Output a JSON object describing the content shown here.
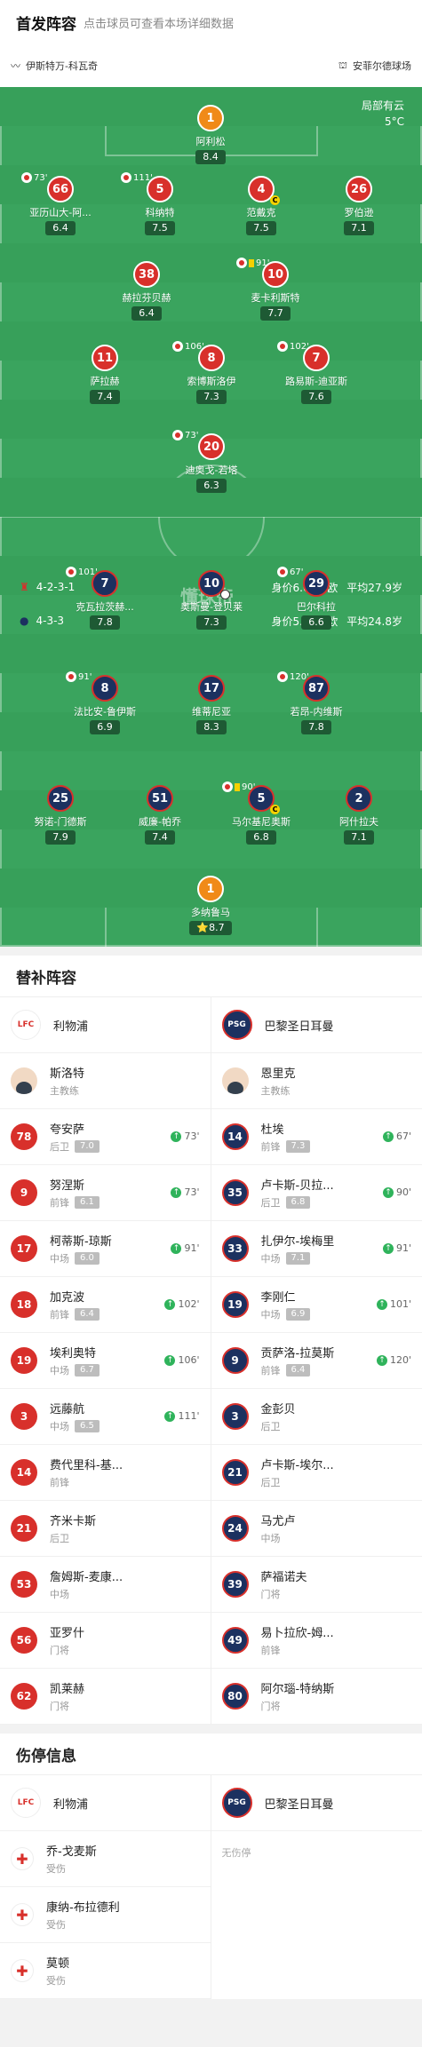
{
  "header": {
    "title": "首发阵容",
    "subtitle": "点击球员可查看本场详细数据"
  },
  "venue": {
    "referee": "伊斯特万-科瓦奇",
    "stadium": "安菲尔德球场"
  },
  "weather": {
    "desc": "局部有云",
    "temp": "5°C"
  },
  "watermark": "懂球帝",
  "home": {
    "formation": "4-2-3-1",
    "value": "身价6.03亿欧",
    "age": "平均27.9岁"
  },
  "away": {
    "formation": "4-3-3",
    "value": "身价5.85亿欧",
    "age": "平均24.8岁"
  },
  "home_players": [
    {
      "num": "1",
      "name": "阿利松",
      "rating": "8.4",
      "gk": true
    },
    {
      "num": "66",
      "name": "亚历山大-阿...",
      "rating": "6.4",
      "sub": "73'"
    },
    {
      "num": "5",
      "name": "科纳特",
      "rating": "7.5",
      "sub": "111'"
    },
    {
      "num": "4",
      "name": "范戴克",
      "rating": "7.5",
      "captain": true
    },
    {
      "num": "26",
      "name": "罗伯逊",
      "rating": "7.1"
    },
    {
      "num": "38",
      "name": "赫拉芬贝赫",
      "rating": "6.4"
    },
    {
      "num": "10",
      "name": "麦卡利斯特",
      "rating": "7.7",
      "sub": "91'",
      "yellow": true
    },
    {
      "num": "11",
      "name": "萨拉赫",
      "rating": "7.4"
    },
    {
      "num": "8",
      "name": "索博斯洛伊",
      "rating": "7.3",
      "sub": "106'"
    },
    {
      "num": "7",
      "name": "路易斯-迪亚斯",
      "rating": "7.6",
      "sub": "102'"
    },
    {
      "num": "20",
      "name": "迪奥戈-若塔",
      "rating": "6.3",
      "sub": "73'"
    }
  ],
  "away_players": [
    {
      "num": "7",
      "name": "克瓦拉茨赫...",
      "rating": "7.8",
      "sub": "101'"
    },
    {
      "num": "10",
      "name": "奥斯曼-登贝莱",
      "rating": "7.3",
      "goal": true
    },
    {
      "num": "29",
      "name": "巴尔科拉",
      "rating": "6.6",
      "sub": "67'"
    },
    {
      "num": "8",
      "name": "法比安-鲁伊斯",
      "rating": "6.9",
      "sub": "91'"
    },
    {
      "num": "17",
      "name": "维蒂尼亚",
      "rating": "8.3"
    },
    {
      "num": "87",
      "name": "若昂-内维斯",
      "rating": "7.8",
      "sub": "120'"
    },
    {
      "num": "25",
      "name": "努诺-门德斯",
      "rating": "7.9"
    },
    {
      "num": "51",
      "name": "威廉-帕乔",
      "rating": "7.4"
    },
    {
      "num": "5",
      "name": "马尔基尼奥斯",
      "rating": "6.8",
      "sub": "90'",
      "yellow": true,
      "captain": true
    },
    {
      "num": "2",
      "name": "阿什拉夫",
      "rating": "7.1"
    },
    {
      "num": "1",
      "name": "多纳鲁马",
      "rating": "8.7",
      "gk": true,
      "star": "⭐"
    }
  ],
  "subs": {
    "title": "替补阵容",
    "home_team": "利物浦",
    "away_team": "巴黎圣日耳曼",
    "home_coach": {
      "name": "斯洛特",
      "role": "主教练"
    },
    "away_coach": {
      "name": "恩里克",
      "role": "主教练"
    },
    "home": [
      {
        "num": "78",
        "name": "夸安萨",
        "pos": "后卫",
        "rating": "7.0",
        "on": "73'"
      },
      {
        "num": "9",
        "name": "努涅斯",
        "pos": "前锋",
        "rating": "6.1",
        "on": "73'"
      },
      {
        "num": "17",
        "name": "柯蒂斯-琼斯",
        "pos": "中场",
        "rating": "6.0",
        "on": "91'"
      },
      {
        "num": "18",
        "name": "加克波",
        "pos": "前锋",
        "rating": "6.4",
        "on": "102'"
      },
      {
        "num": "19",
        "name": "埃利奥特",
        "pos": "中场",
        "rating": "6.7",
        "on": "106'"
      },
      {
        "num": "3",
        "name": "远藤航",
        "pos": "中场",
        "rating": "6.5",
        "on": "111'"
      },
      {
        "num": "14",
        "name": "费代里科-基...",
        "pos": "前锋"
      },
      {
        "num": "21",
        "name": "齐米卡斯",
        "pos": "后卫"
      },
      {
        "num": "53",
        "name": "詹姆斯-麦康...",
        "pos": "中场"
      },
      {
        "num": "56",
        "name": "亚罗什",
        "pos": "门将"
      },
      {
        "num": "62",
        "name": "凯莱赫",
        "pos": "门将"
      }
    ],
    "away": [
      {
        "num": "14",
        "name": "杜埃",
        "pos": "前锋",
        "rating": "7.3",
        "on": "67'"
      },
      {
        "num": "35",
        "name": "卢卡斯-贝拉...",
        "pos": "后卫",
        "rating": "6.8",
        "on": "90'"
      },
      {
        "num": "33",
        "name": "扎伊尔-埃梅里",
        "pos": "中场",
        "rating": "7.1",
        "on": "91'"
      },
      {
        "num": "19",
        "name": "李刚仁",
        "pos": "中场",
        "rating": "6.9",
        "on": "101'"
      },
      {
        "num": "9",
        "name": "贡萨洛-拉莫斯",
        "pos": "前锋",
        "rating": "6.4",
        "on": "120'"
      },
      {
        "num": "3",
        "name": "金彭贝",
        "pos": "后卫"
      },
      {
        "num": "21",
        "name": "卢卡斯-埃尔...",
        "pos": "后卫"
      },
      {
        "num": "24",
        "name": "马尤卢",
        "pos": "中场"
      },
      {
        "num": "39",
        "name": "萨福诺夫",
        "pos": "门将"
      },
      {
        "num": "49",
        "name": "易卜拉欣-姆...",
        "pos": "前锋"
      },
      {
        "num": "80",
        "name": "阿尔瑙-特纳斯",
        "pos": "门将"
      }
    ]
  },
  "injuries": {
    "title": "伤停信息",
    "home": [
      {
        "name": "乔-戈麦斯",
        "status": "受伤"
      },
      {
        "name": "康纳-布拉德利",
        "status": "受伤"
      },
      {
        "name": "莫顿",
        "status": "受伤"
      }
    ],
    "away_none": "无伤停"
  },
  "colors": {
    "pitch": "#3aa45e",
    "home": "#d8302b",
    "away": "#1c3160",
    "gk": "#f08a18"
  }
}
